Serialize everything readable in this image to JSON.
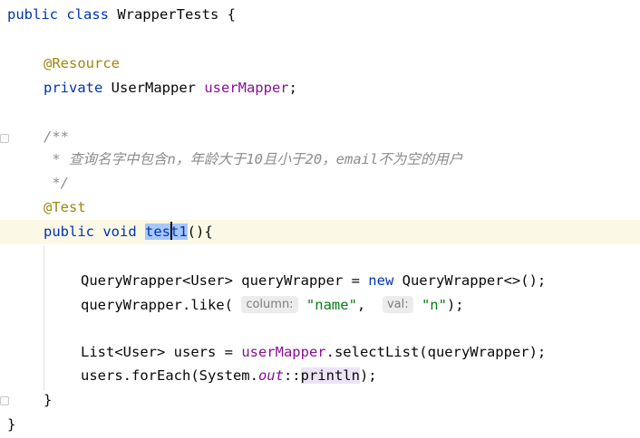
{
  "editor": {
    "lines": {
      "class_decl": {
        "kw": "public class",
        "name": " WrapperTests {"
      },
      "annotation_resource": "@Resource",
      "field_decl": {
        "kw": "private",
        "type": " UserMapper ",
        "name": "userMapper",
        "end": ";"
      },
      "doc_open": "/**",
      "doc_text": " * 查询名字中包含n，年龄大于10且小于20，email不为空的用户",
      "doc_close": " */",
      "annotation_test": "@Test",
      "method_decl": {
        "kw": "public void ",
        "name_sel": "tes",
        "name_caret_after": "t1",
        "rest": "(){"
      },
      "qw_decl": {
        "type": "QueryWrapper<User> queryWrapper = ",
        "kw": "new",
        "rest": " QueryWrapper<>();"
      },
      "qw_like": {
        "call": "queryWrapper.like(",
        "hint1": "column:",
        "arg1": "\"name\"",
        "sep": ", ",
        "hint2": "val:",
        "arg2": "\"n\"",
        "end": ");"
      },
      "list_decl": {
        "type": "List<User> users = ",
        "field": "userMapper",
        "rest": ".selectList(queryWrapper);"
      },
      "for_each": {
        "start": "users.forEach(System.",
        "static": "out",
        "ref": "::",
        "method": "println",
        "end": ");"
      },
      "method_close": "}",
      "class_close": "}"
    }
  }
}
